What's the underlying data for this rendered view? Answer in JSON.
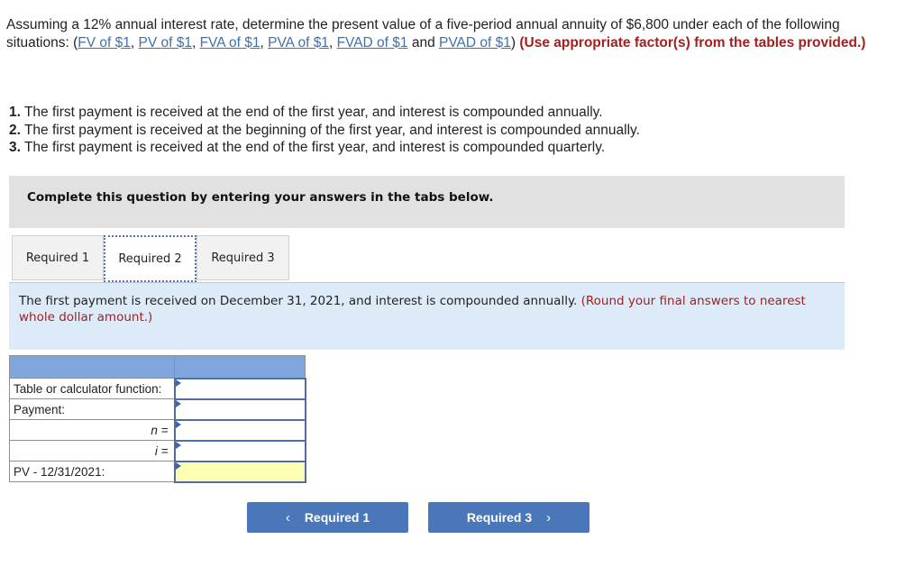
{
  "question": {
    "intro_text_1": "Assuming a 12% annual interest rate, determine the present value of a five-period annual annuity of $6,800 under each of the following situations: ",
    "open_paren": "(",
    "links": [
      "FV of $1",
      "PV of $1",
      "FVA of $1",
      "PVA of $1",
      "FVAD of $1",
      "PVAD of $1"
    ],
    "and_word": " and ",
    "close_paren": ")",
    "instruction_red": "(Use appropriate factor(s) from the tables provided.)",
    "parts": [
      {
        "number": "1.",
        "text": " The first payment is received at the end of the first year, and interest is compounded annually."
      },
      {
        "number": "2.",
        "text": " The first payment is received at the beginning of the first year, and interest is compounded annually."
      },
      {
        "number": "3.",
        "text": " The first payment is received at the end of the first year, and interest is compounded quarterly."
      }
    ]
  },
  "instruction_bar": "Complete this question by entering your answers in the tabs below.",
  "tabs": [
    {
      "label": "Required 1",
      "active": false
    },
    {
      "label": "Required 2",
      "active": true
    },
    {
      "label": "Required 3",
      "active": false
    }
  ],
  "panel": {
    "text": "The first payment is received on December 31, 2021, and interest is compounded annually. ",
    "red_text": "(Round your final answers to nearest whole dollar amount.)"
  },
  "calc_table": {
    "rows": [
      {
        "label": "Table or calculator function:",
        "value": ""
      },
      {
        "label": "Payment:",
        "value": ""
      },
      {
        "label": "n =",
        "value": ""
      },
      {
        "label": "i =",
        "value": ""
      },
      {
        "label": "PV - 12/31/2021:",
        "value": ""
      }
    ]
  },
  "nav": {
    "prev_label": "Required 1",
    "next_label": "Required 3",
    "prev_icon": "‹",
    "next_icon": "›"
  },
  "colors": {
    "link": "#3d6fb5",
    "red": "#a4201f",
    "button": "#4a77b9",
    "table_header": "#7fa6dc",
    "answer_highlight": "#ffffb4",
    "panel_bg": "#ddebf8"
  }
}
